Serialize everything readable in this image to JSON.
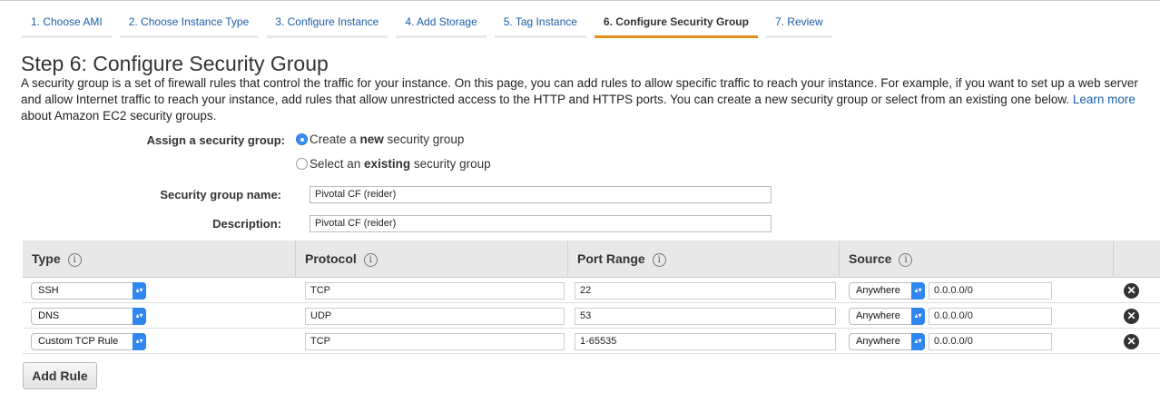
{
  "tabs": [
    "1. Choose AMI",
    "2. Choose Instance Type",
    "3. Configure Instance",
    "4. Add Storage",
    "5. Tag Instance",
    "6. Configure Security Group",
    "7. Review"
  ],
  "active_tab": 5,
  "title": "Step 6: Configure Security Group",
  "desc_1": "A security group is a set of firewall rules that control the traffic for your instance. On this page, you can add rules to allow specific traffic to reach your instance. For example, if you want to set up a web server and allow Internet traffic to reach your instance, add rules that allow unrestricted access to the HTTP and HTTPS ports. You can create a new security group or select from an existing one below.",
  "learn_more": "Learn more",
  "desc_2": "about Amazon EC2 security groups.",
  "assign_label": "Assign a security group:",
  "radio_new": {
    "pre": "Create a ",
    "bold": "new",
    "post": " security group"
  },
  "radio_existing": {
    "pre": "Select an ",
    "bold": "existing",
    "post": " security group"
  },
  "name_label": "Security group name:",
  "name_value": "Pivotal CF (reider)",
  "description_label": "Description:",
  "description_value": "Pivotal CF (reider)",
  "columns": [
    "Type",
    "Protocol",
    "Port Range",
    "Source"
  ],
  "info_glyph": "i",
  "rows": [
    {
      "type": "SSH",
      "protocol": "TCP",
      "port": "22",
      "source": "Anywhere",
      "cidr": "0.0.0.0/0"
    },
    {
      "type": "DNS",
      "protocol": "UDP",
      "port": "53",
      "source": "Anywhere",
      "cidr": "0.0.0.0/0"
    },
    {
      "type": "Custom TCP Rule",
      "protocol": "TCP",
      "port": "1-65535",
      "source": "Anywhere",
      "cidr": "0.0.0.0/0"
    }
  ],
  "add_rule": "Add Rule",
  "colors": {
    "link": "#1a5ea8",
    "active_tab": "#e88f19",
    "select_arrow": "#2e86f0"
  }
}
